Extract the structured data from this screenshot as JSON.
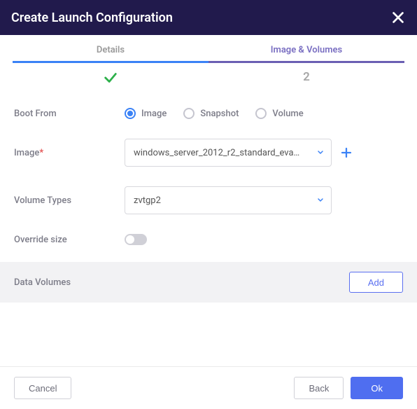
{
  "header": {
    "title": "Create Launch Configuration"
  },
  "tabs": {
    "details": "Details",
    "image_volumes": "Image & Volumes"
  },
  "steps": {
    "second": "2"
  },
  "form": {
    "boot_from_label": "Boot From",
    "boot_options": {
      "image": "Image",
      "snapshot": "Snapshot",
      "volume": "Volume"
    },
    "image_label": "Image",
    "image_value": "windows_server_2012_r2_standard_eva…",
    "volume_types_label": "Volume Types",
    "volume_types_value": "zvtgp2",
    "override_size_label": "Override size"
  },
  "section": {
    "data_volumes_label": "Data Volumes",
    "add_label": "Add"
  },
  "footer": {
    "cancel": "Cancel",
    "back": "Back",
    "ok": "Ok"
  }
}
